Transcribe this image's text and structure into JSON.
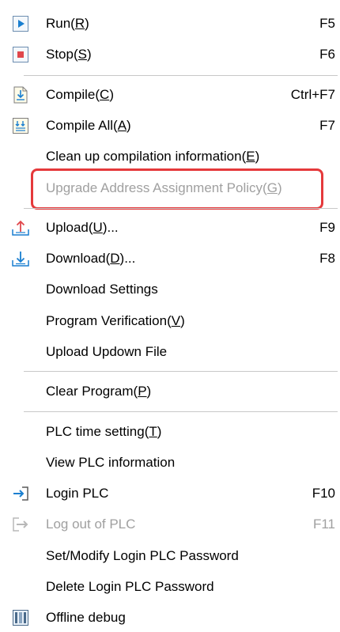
{
  "menu": {
    "run": {
      "label": "Run(",
      "mn": "R",
      "tail": ")",
      "shortcut": "F5",
      "icon": "run-icon"
    },
    "stop": {
      "label": "Stop(",
      "mn": "S",
      "tail": ")",
      "shortcut": "F6",
      "icon": "stop-icon"
    },
    "compile": {
      "label": "Compile(",
      "mn": "C",
      "tail": ")",
      "shortcut": "Ctrl+F7",
      "icon": "compile-icon"
    },
    "compile_all": {
      "label": "Compile All(",
      "mn": "A",
      "tail": ")",
      "shortcut": "F7",
      "icon": "compile-all-icon"
    },
    "cleanup": {
      "label": "Clean up compilation information(",
      "mn": "E",
      "tail": ")"
    },
    "upgrade": {
      "label": "Upgrade Address Assignment Policy(",
      "mn": "G",
      "tail": ")",
      "disabled": true
    },
    "upload": {
      "label": "Upload(",
      "mn": "U",
      "tail": ")...",
      "shortcut": "F9",
      "icon": "upload-icon"
    },
    "download": {
      "label": "Download(",
      "mn": "D",
      "tail": ")...",
      "shortcut": "F8",
      "icon": "download-icon"
    },
    "download_settings": {
      "label": "Download Settings"
    },
    "program_verification": {
      "label": "Program Verification(",
      "mn": "V",
      "tail": ")"
    },
    "upload_updown": {
      "label": "Upload Updown File"
    },
    "clear_program": {
      "label": "Clear Program(",
      "mn": "P",
      "tail": ")"
    },
    "plc_time": {
      "label": "PLC time setting(",
      "mn": "T",
      "tail": ")"
    },
    "view_plc": {
      "label": "View PLC information"
    },
    "login_plc": {
      "label": "Login PLC",
      "shortcut": "F10",
      "icon": "login-icon"
    },
    "logout_plc": {
      "label": "Log out of PLC",
      "shortcut": "F11",
      "icon": "logout-icon",
      "disabled": true
    },
    "set_password": {
      "label": "Set/Modify Login PLC Password"
    },
    "delete_password": {
      "label": "Delete Login PLC Password"
    },
    "offline_debug": {
      "label": "Offline debug",
      "icon": "offline-debug-icon"
    }
  },
  "colors": {
    "highlight": "#e5393b",
    "accent": "#1a7fd0",
    "disabled": "#a0a0a0"
  }
}
